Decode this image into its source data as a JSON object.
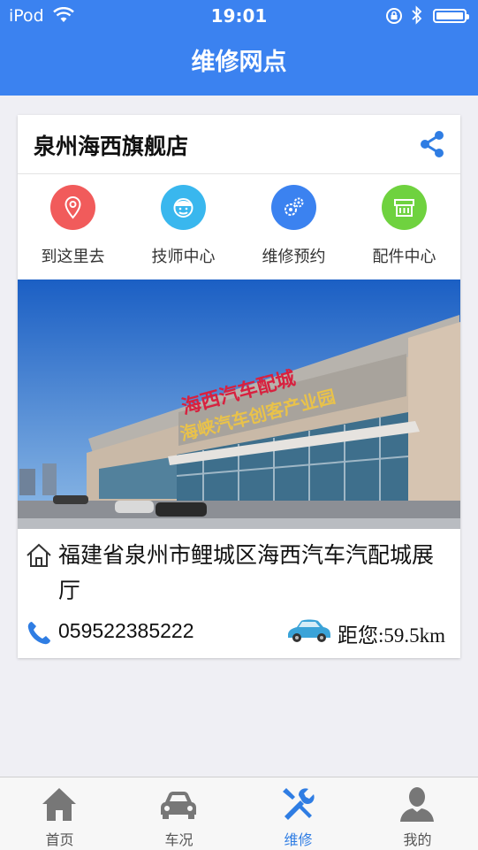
{
  "status_bar": {
    "carrier": "iPod",
    "time": "19:01"
  },
  "nav": {
    "title": "维修网点"
  },
  "store": {
    "name": "泉州海西旗舰店",
    "address": "福建省泉州市鲤城区海西汽车汽配城展厅",
    "phone": "059522385222",
    "distance": "距您:59.5km"
  },
  "actions": [
    {
      "label": "到这里去",
      "icon": "location-pin-icon",
      "color": "#f15b5b"
    },
    {
      "label": "技师中心",
      "icon": "technician-icon",
      "color": "#39b7ee"
    },
    {
      "label": "维修预约",
      "icon": "gears-icon",
      "color": "#3b82f0"
    },
    {
      "label": "配件中心",
      "icon": "parts-store-icon",
      "color": "#6fd23f"
    }
  ],
  "photo": {
    "sign_text": "海西汽车配城",
    "sign_subtext": "海峡汽车创客产业园"
  },
  "tabs": [
    {
      "label": "首页",
      "icon": "home-icon",
      "active": false
    },
    {
      "label": "车况",
      "icon": "car-icon",
      "active": false
    },
    {
      "label": "维修",
      "icon": "tools-icon",
      "active": true
    },
    {
      "label": "我的",
      "icon": "person-icon",
      "active": false
    }
  ],
  "colors": {
    "primary": "#3b82f0",
    "active_tab": "#2f7de3"
  }
}
